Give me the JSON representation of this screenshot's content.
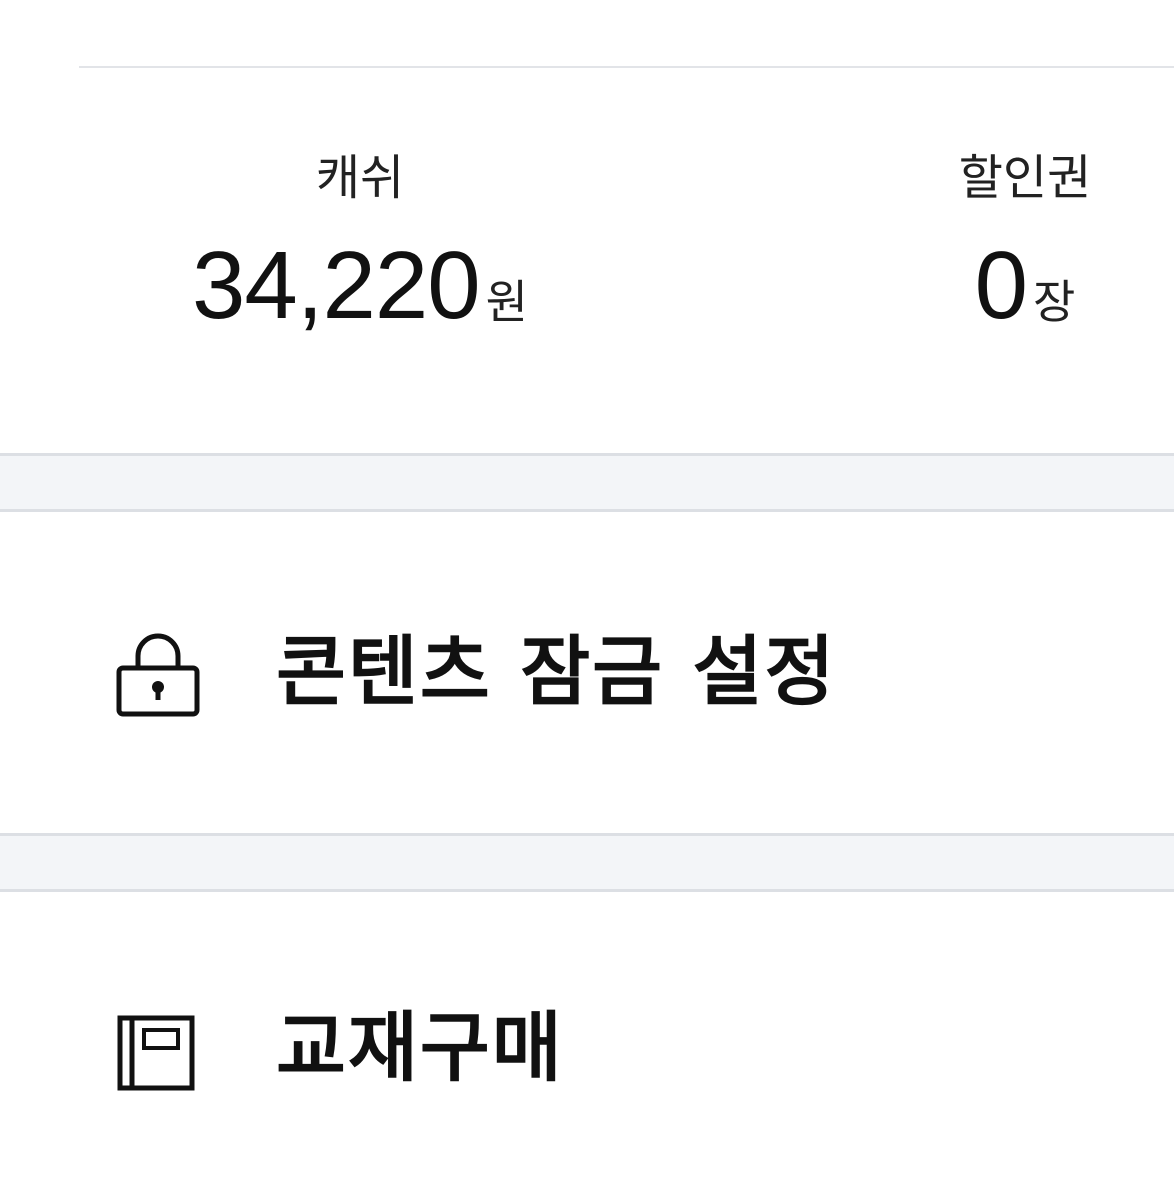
{
  "balance": {
    "cash": {
      "label": "캐쉬",
      "value": "34,220",
      "unit": "원"
    },
    "coupon": {
      "label": "할인권",
      "value": "0",
      "unit": "장"
    }
  },
  "menu": {
    "items": [
      {
        "label": "콘텐츠 잠금 설정",
        "icon": "lock-icon"
      },
      {
        "label": "교재구매",
        "icon": "book-icon"
      }
    ]
  },
  "colors": {
    "divider": "#dcdfe4",
    "band": "#f3f5f8",
    "text": "#111111"
  }
}
